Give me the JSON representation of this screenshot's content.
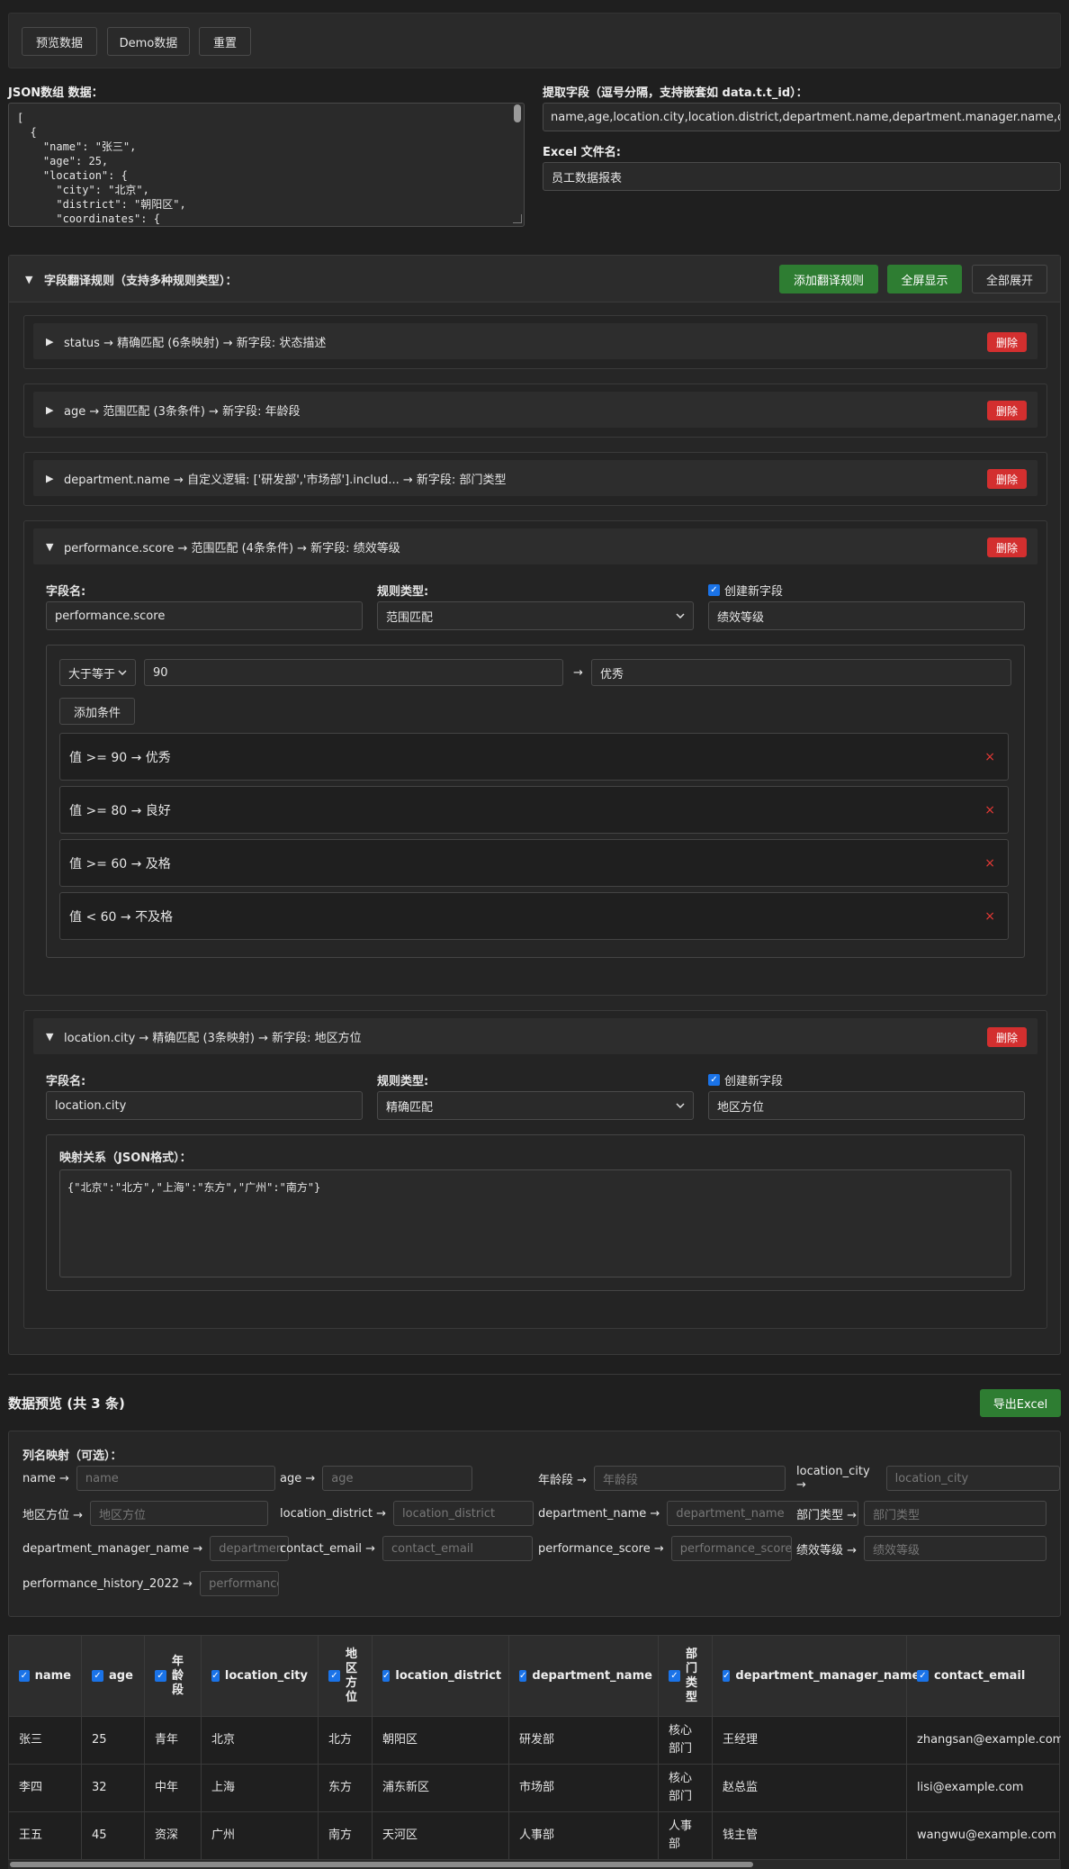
{
  "toolbar": {
    "preview": "预览数据",
    "demo": "Demo数据",
    "reset": "重置"
  },
  "json_section": {
    "label": "JSON数组 数据：",
    "text": "[\n  {\n    \"name\": \"张三\",\n    \"age\": 25,\n    \"location\": {\n      \"city\": \"北京\",\n      \"district\": \"朝阳区\",\n      \"coordinates\": {"
  },
  "fields_section": {
    "label": "提取字段（逗号分隔，支持嵌套如 data.t.t_id）：",
    "value": "name,age,location.city,location.district,department.name,department.manager.name,contact.email"
  },
  "excel_section": {
    "label": "Excel 文件名:",
    "value": "员工数据报表"
  },
  "rules_panel": {
    "title": "字段翻译规则（支持多种规则类型）：",
    "add_label": "添加翻译规则",
    "fullscreen_label": "全屏显示",
    "expand_label": "全部展开",
    "delete_label": "删除",
    "collapsed_icon": "▶",
    "expanded_icon": "▼",
    "collapsed": [
      "status → 精确匹配 (6条映射) → 新字段: 状态描述",
      "age → 范围匹配 (3条条件) → 新字段: 年龄段",
      "department.name → 自定义逻辑: ['研发部','市场部'].includ... → 新字段: 部门类型"
    ],
    "perf_rule": {
      "title": "performance.score → 范围匹配 (4条条件) → 新字段: 绩效等级",
      "field_label": "字段名:",
      "field_value": "performance.score",
      "type_label": "规则类型:",
      "type_value": "范围匹配",
      "new_field_label": "创建新字段",
      "new_field_value": "绩效等级",
      "op_value": "大于等于",
      "num_value": "90",
      "arrow": "→",
      "result_value": "优秀",
      "add_cond_label": "添加条件",
      "conditions": [
        "值 >= 90 → 优秀",
        "值 >= 80 → 良好",
        "值 >= 60 → 及格",
        "值 < 60 → 不及格"
      ],
      "remove_icon": "×"
    },
    "city_rule": {
      "title": "location.city → 精确匹配 (3条映射) → 新字段: 地区方位",
      "field_label": "字段名:",
      "field_value": "location.city",
      "type_label": "规则类型:",
      "type_value": "精确匹配",
      "new_field_label": "创建新字段",
      "new_field_value": "地区方位",
      "mapping_label": "映射关系（JSON格式）：",
      "mapping_value": "{\"北京\":\"北方\",\"上海\":\"东方\",\"广州\":\"南方\"}"
    }
  },
  "preview": {
    "title": "数据预览 (共 3 条)",
    "export_label": "导出Excel",
    "mapping_title": "列名映射（可选）：",
    "mappings": [
      {
        "label": "name →",
        "placeholder": "name"
      },
      {
        "label": "age →",
        "placeholder": "age"
      },
      {
        "label": "年龄段 →",
        "placeholder": "年龄段"
      },
      {
        "label": "location_city →",
        "placeholder": "location_city"
      },
      {
        "label": "地区方位 →",
        "placeholder": "地区方位"
      },
      {
        "label": "location_district →",
        "placeholder": "location_district"
      },
      {
        "label": "department_name →",
        "placeholder": "department_name"
      },
      {
        "label": "部门类型 →",
        "placeholder": "部门类型"
      },
      {
        "label": "department_manager_name →",
        "placeholder": "departmen"
      },
      {
        "label": "contact_email →",
        "placeholder": "contact_email"
      },
      {
        "label": "performance_score →",
        "placeholder": "performance_score"
      },
      {
        "label": "绩效等级 →",
        "placeholder": "绩效等级"
      },
      {
        "label": "performance_history_2022 →",
        "placeholder": "performance"
      }
    ],
    "columns": [
      "name",
      "age",
      "年龄段",
      "location_city",
      "地区方位",
      "location_district",
      "department_name",
      "部门类型",
      "department_manager_name",
      "contact_email"
    ],
    "rows": [
      [
        "张三",
        "25",
        "青年",
        "北京",
        "北方",
        "朝阳区",
        "研发部",
        "核心部门",
        "王经理",
        "zhangsan@example.com"
      ],
      [
        "李四",
        "32",
        "中年",
        "上海",
        "东方",
        "浦东新区",
        "市场部",
        "核心部门",
        "赵总监",
        "lisi@example.com"
      ],
      [
        "王五",
        "45",
        "资深",
        "广州",
        "南方",
        "天河区",
        "人事部",
        "人事部",
        "钱主管",
        "wangwu@example.com"
      ]
    ]
  },
  "icons": {
    "checkbox": "check-icon",
    "chevron": "chevron-down-icon"
  }
}
